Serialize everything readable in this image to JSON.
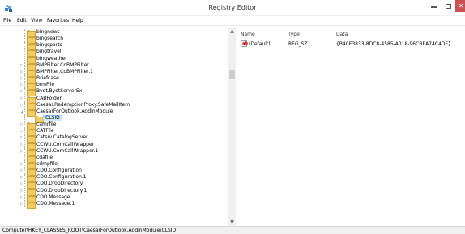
{
  "window": {
    "title": "Registry Editor",
    "close_glyph": "✕",
    "app_icon": "registry-editor-icon"
  },
  "menu": [
    {
      "label": "File",
      "mnemonic": "F",
      "rest": "ile"
    },
    {
      "label": "Edit",
      "mnemonic": "E",
      "rest": "dit"
    },
    {
      "label": "View",
      "mnemonic": "V",
      "rest": "iew"
    },
    {
      "label": "Favorites",
      "mnemonic": "",
      "rest": "Favorites"
    },
    {
      "label": "Help",
      "mnemonic": "H",
      "rest": "elp"
    }
  ],
  "tree": {
    "items": [
      {
        "label": "bingnews",
        "expandable": false
      },
      {
        "label": "bingsearch",
        "expandable": false
      },
      {
        "label": "bingsports",
        "expandable": false
      },
      {
        "label": "bingtravel",
        "expandable": false
      },
      {
        "label": "bingweather",
        "expandable": false
      },
      {
        "label": "BMPFilter.CoBMPFilter",
        "expandable": true
      },
      {
        "label": "BMPFilter.CoBMPFilter.1",
        "expandable": true
      },
      {
        "label": "Briefcase",
        "expandable": true
      },
      {
        "label": "brmFile",
        "expandable": true
      },
      {
        "label": "Byot.ByotServerEx",
        "expandable": true
      },
      {
        "label": "CABFolder",
        "expandable": true
      },
      {
        "label": "Caesar.RedemptionProxy.SafeMailItem",
        "expandable": true
      },
      {
        "label": "CaesarForOutlook.AddinModule",
        "expandable": true,
        "expanded": true
      },
      {
        "label": "CLSID",
        "expandable": false,
        "child": true,
        "selected": true
      },
      {
        "label": "camrfile",
        "expandable": true
      },
      {
        "label": "CATFile",
        "expandable": true
      },
      {
        "label": "Catsrv.CatalogServer",
        "expandable": true
      },
      {
        "label": "CCWU.ComCallWrapper",
        "expandable": true
      },
      {
        "label": "CCWU.ComCallWrapper.1",
        "expandable": true
      },
      {
        "label": "cdafile",
        "expandable": false
      },
      {
        "label": "cdmpfile",
        "expandable": true
      },
      {
        "label": "CDO.Configuration",
        "expandable": true
      },
      {
        "label": "CDO.Configuration.1",
        "expandable": true
      },
      {
        "label": "CDO.DropDirectory",
        "expandable": true
      },
      {
        "label": "CDO.DropDirectory.1",
        "expandable": true
      },
      {
        "label": "CDO.Message",
        "expandable": true
      },
      {
        "label": "CDO.Message.1",
        "expandable": true
      }
    ]
  },
  "list": {
    "headers": {
      "name": "Name",
      "type": "Type",
      "data": "Data"
    },
    "rows": [
      {
        "name": "(Default)",
        "type": "REG_SZ",
        "data": "{B40E3833-8DC8-4585-A018-96CBEA74C4DF}",
        "icon": "ab"
      }
    ]
  },
  "status": {
    "path": "Computer\\HKEY_CLASSES_ROOT\\CaesarForOutlook.AddinModule\\CLSID"
  }
}
